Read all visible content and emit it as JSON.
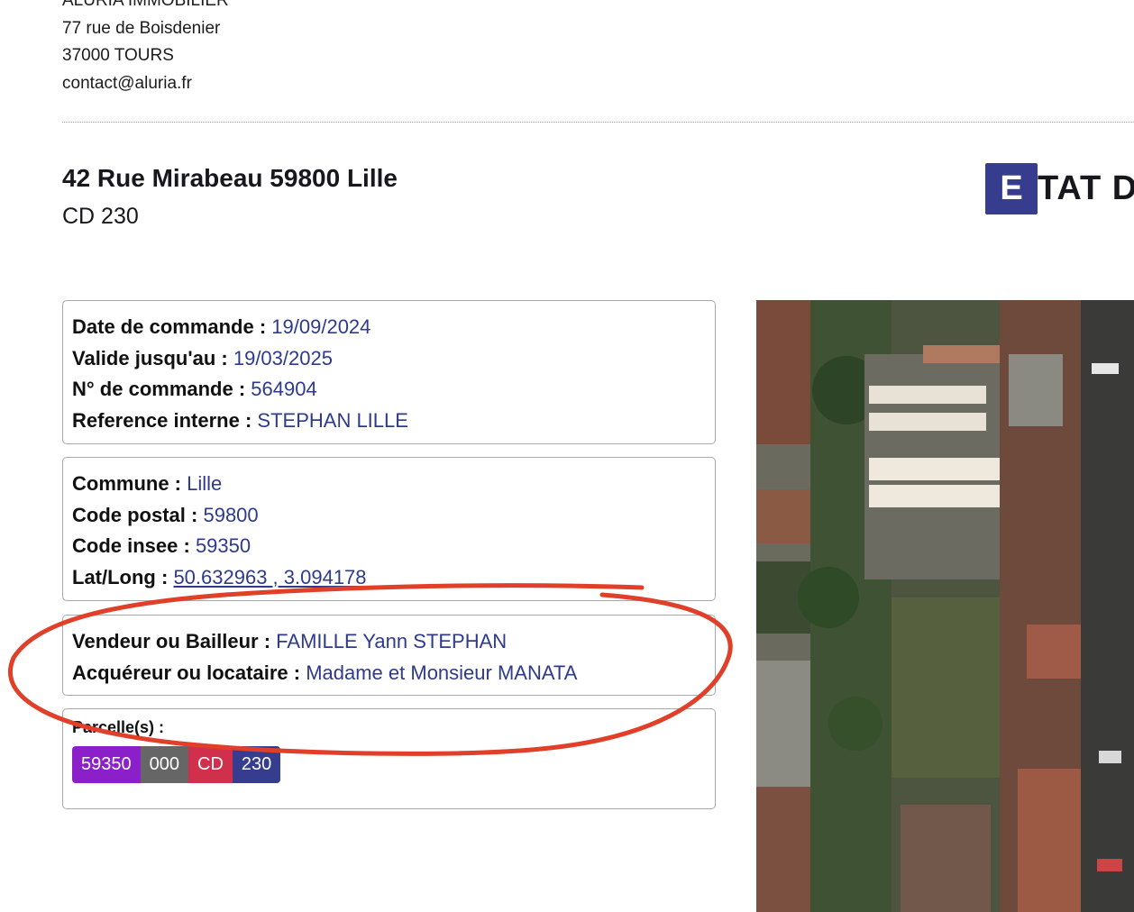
{
  "company": {
    "name": "ALURIA IMMOBILIER",
    "street": "77 rue de Boisdenier",
    "city": "37000 TOURS",
    "email": "contact@aluria.fr"
  },
  "property": {
    "address": "42 Rue Mirabeau 59800 Lille",
    "cadastre": "CD 230"
  },
  "heading": {
    "letter": "E",
    "rest": "TAT D"
  },
  "order": {
    "date_label": "Date de commande :",
    "date_value": "19/09/2024",
    "valid_label": "Valide jusqu'au :",
    "valid_value": "19/03/2025",
    "number_label": "N° de commande :",
    "number_value": "564904",
    "ref_label": "Reference interne :",
    "ref_value": "STEPHAN LILLE"
  },
  "location": {
    "commune_label": "Commune :",
    "commune_value": "Lille",
    "postal_label": "Code postal :",
    "postal_value": "59800",
    "insee_label": "Code insee :",
    "insee_value": "59350",
    "latlong_label": "Lat/Long :",
    "latlong_value": "50.632963 , 3.094178"
  },
  "parties": {
    "seller_label": "Vendeur ou Bailleur :",
    "seller_value": "FAMILLE Yann STEPHAN",
    "buyer_label": "Acquéreur ou locataire :",
    "buyer_value": "Madame et Monsieur MANATA"
  },
  "parcels": {
    "label": "Parcelle(s) :",
    "tags": [
      {
        "text": "59350",
        "color": "#8b1fc9"
      },
      {
        "text": "000",
        "color": "#666666"
      },
      {
        "text": "CD",
        "color": "#d1304d"
      },
      {
        "text": "230",
        "color": "#363d8f"
      }
    ]
  },
  "colors": {
    "accent": "#363d8f",
    "value_text": "#2e3a8c",
    "annotation": "#e0402a"
  },
  "map": {
    "icon": "aerial-map-image"
  }
}
